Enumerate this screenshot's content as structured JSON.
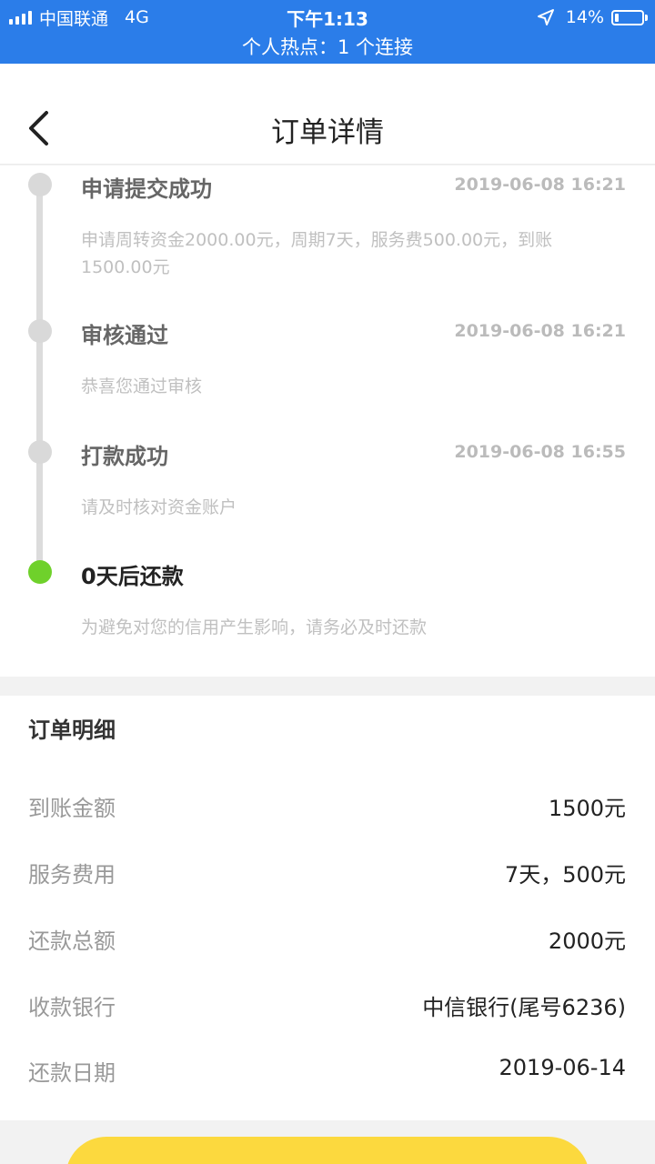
{
  "status_bar": {
    "carrier": "中国联通",
    "network": "4G",
    "time": "下午1:13",
    "battery": "14%",
    "hotspot": "个人热点：1 个连接"
  },
  "nav": {
    "title": "订单详情",
    "back_icon": "chevron-left-icon"
  },
  "timeline": [
    {
      "title": "申请提交成功",
      "time": "2019-06-08 16:21",
      "desc": "申请周转资金2000.00元，周期7天，服务费500.00元，到账1500.00元"
    },
    {
      "title": "审核通过",
      "time": "2019-06-08 16:21",
      "desc": "恭喜您通过审核"
    },
    {
      "title": "打款成功",
      "time": "2019-06-08 16:55",
      "desc": "请及时核对资金账户"
    },
    {
      "title": "0天后还款",
      "time": "",
      "desc": "为避免对您的信用产生影响，请务必及时还款"
    }
  ],
  "details": {
    "heading": "订单明细",
    "rows": [
      {
        "label": "到账金额",
        "value": "1500元"
      },
      {
        "label": "服务费用",
        "value": "7天，500元"
      },
      {
        "label": "还款总额",
        "value": "2000元"
      },
      {
        "label": "收款银行",
        "value": "中信银行(尾号6236)"
      },
      {
        "label": "还款日期",
        "value": "2019-06-14"
      }
    ]
  },
  "colors": {
    "status_bar": "#2b7de9",
    "active_dot": "#6fd12b",
    "button": "#fcd93e"
  }
}
